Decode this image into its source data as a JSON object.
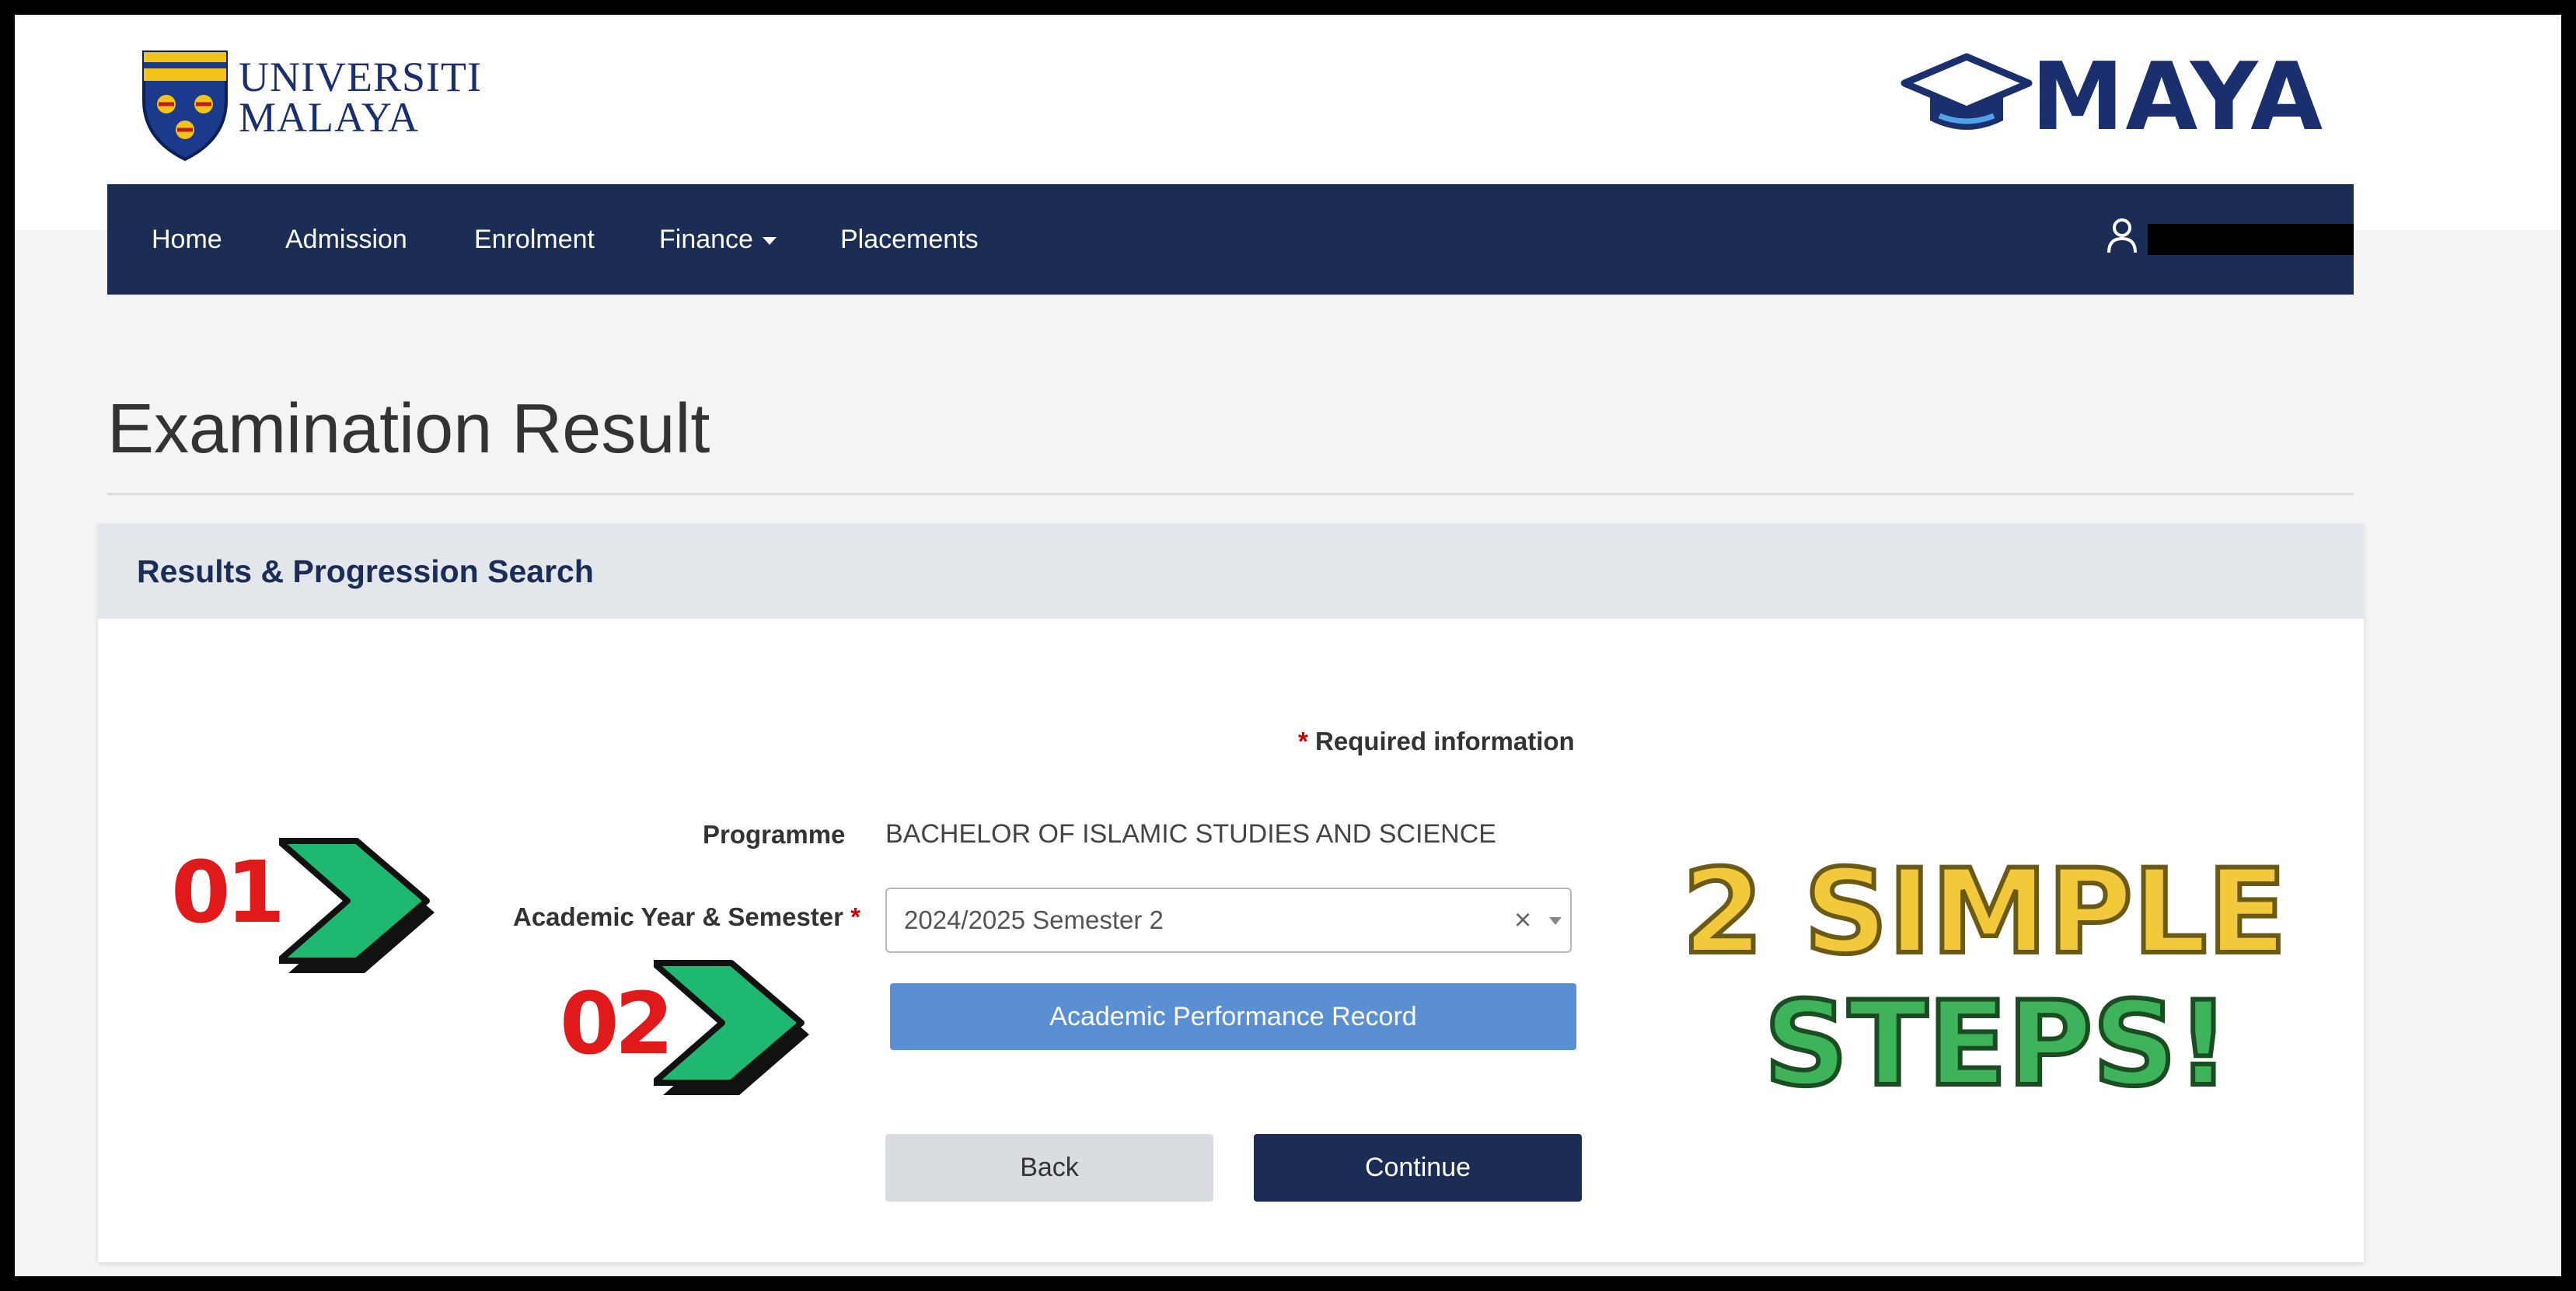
{
  "header": {
    "university_name": [
      "UNIVERSITI",
      "MALAYA"
    ],
    "portal_name": "MAYA"
  },
  "nav": {
    "items": [
      {
        "label": "Home"
      },
      {
        "label": "Admission"
      },
      {
        "label": "Enrolment"
      },
      {
        "label": "Finance",
        "has_dropdown": true
      },
      {
        "label": "Placements"
      }
    ],
    "user_icon": "user-icon"
  },
  "page": {
    "title": "Examination Result"
  },
  "panel": {
    "title": "Results & Progression Search",
    "required_star": "*",
    "required_text": "Required information",
    "programme_label": "Programme",
    "programme_value": "BACHELOR OF ISLAMIC STUDIES AND SCIENCE",
    "semester_label": "Academic Year & Semester",
    "semester_star": "*",
    "semester_value": "2024/2025 Semester 2",
    "clear_glyph": "×",
    "apr_button": "Academic Performance Record",
    "back_button": "Back",
    "continue_button": "Continue"
  },
  "annotations": {
    "step1": "01",
    "step2": "02",
    "promo_line1": "2 SIMPLE",
    "promo_line2": "STEPS!",
    "colors": {
      "step_number": "#e01a1a",
      "arrow": "#1fb870",
      "promo_line1": "#f3c93c",
      "promo_line2": "#3fb35c"
    }
  },
  "colors": {
    "navbar": "#1b2c55",
    "brand_text": "#1b2f6e",
    "primary_button": "#1b2c55",
    "info_button": "#5b8fd3",
    "secondary_button": "#d9dde2"
  }
}
